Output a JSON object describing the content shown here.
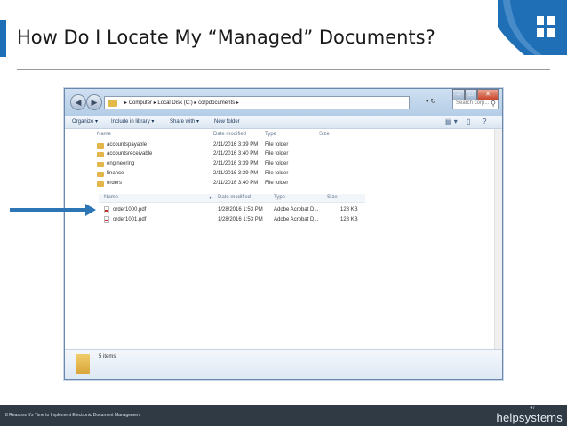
{
  "slide": {
    "title": "How Do I Locate My “Managed” Documents?",
    "footer_text": "8 Reasons It's Time to Implement Electronic Document Management",
    "page_number": "47",
    "brand": "helpsystems"
  },
  "explorer": {
    "address": [
      "Computer",
      "Local Disk (C:)",
      "corpdocuments"
    ],
    "search_placeholder": "Search corp...",
    "toolbar": {
      "organize": "Organize ▾",
      "include": "Include in library ▾",
      "share": "Share with ▾",
      "new_folder": "New folder"
    },
    "folder_columns": [
      "Name",
      "Date modified",
      "Type",
      "Size"
    ],
    "folders": [
      {
        "name": "accountspayable",
        "date": "2/11/2016 3:39 PM",
        "type": "File folder"
      },
      {
        "name": "accountsreceivable",
        "date": "2/11/2016 3:40 PM",
        "type": "File folder"
      },
      {
        "name": "engineering",
        "date": "2/11/2016 3:39 PM",
        "type": "File folder"
      },
      {
        "name": "finance",
        "date": "2/11/2016 3:39 PM",
        "type": "File folder"
      },
      {
        "name": "orders",
        "date": "2/11/2016 3:40 PM",
        "type": "File folder"
      }
    ],
    "file_columns": [
      "Name",
      "Date modified",
      "Type",
      "Size"
    ],
    "files": [
      {
        "name": "order1000.pdf",
        "date": "1/28/2016 1:53 PM",
        "type": "Adobe Acrobat D...",
        "size": "128 KB"
      },
      {
        "name": "order1001.pdf",
        "date": "1/28/2016 1:53 PM",
        "type": "Adobe Acrobat D...",
        "size": "128 KB"
      }
    ],
    "status": "5 items"
  },
  "colors": {
    "accent": "#1f6fb7",
    "arrow": "#2e75b6",
    "footer_bg": "#2f3a45"
  }
}
